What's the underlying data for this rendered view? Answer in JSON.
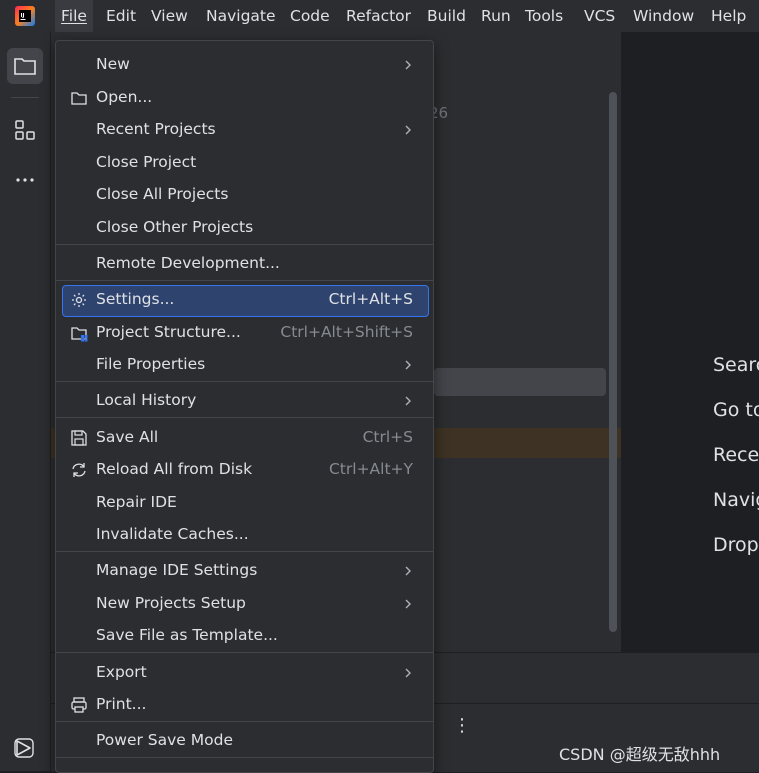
{
  "menubar": {
    "items": [
      {
        "label": "File"
      },
      {
        "label": "Edit"
      },
      {
        "label": "View"
      },
      {
        "label": "Navigate"
      },
      {
        "label": "Code"
      },
      {
        "label": "Refactor"
      },
      {
        "label": "Build"
      },
      {
        "label": "Run"
      },
      {
        "label": "Tools"
      },
      {
        "label": "VCS"
      },
      {
        "label": "Window"
      },
      {
        "label": "Help"
      }
    ],
    "active": "File"
  },
  "panel": {
    "partial_text": "26"
  },
  "file_menu": {
    "new": "New",
    "open": "Open...",
    "recent_projects": "Recent Projects",
    "close_project": "Close Project",
    "close_all_projects": "Close All Projects",
    "close_other_projects": "Close Other Projects",
    "remote_development": "Remote Development...",
    "settings": "Settings...",
    "settings_shortcut": "Ctrl+Alt+S",
    "project_structure": "Project Structure...",
    "project_structure_shortcut": "Ctrl+Alt+Shift+S",
    "file_properties": "File Properties",
    "local_history": "Local History",
    "save_all": "Save All",
    "save_all_shortcut": "Ctrl+S",
    "reload_all": "Reload All from Disk",
    "reload_all_shortcut": "Ctrl+Alt+Y",
    "repair_ide": "Repair IDE",
    "invalidate_caches": "Invalidate Caches...",
    "manage_ide_settings": "Manage IDE Settings",
    "new_projects_setup": "New Projects Setup",
    "save_as_template": "Save File as Template...",
    "export": "Export",
    "print": "Print...",
    "power_save_mode": "Power Save Mode"
  },
  "welcome": {
    "lines": [
      "Searc",
      "Go to",
      "Rece",
      "Navig",
      "Drop"
    ]
  },
  "watermark": "CSDN @超级无敌hhh",
  "colors": {
    "background": "#1e1f22",
    "panel": "#2b2d30",
    "selection": "#2e436e",
    "accent": "#3574f0"
  }
}
